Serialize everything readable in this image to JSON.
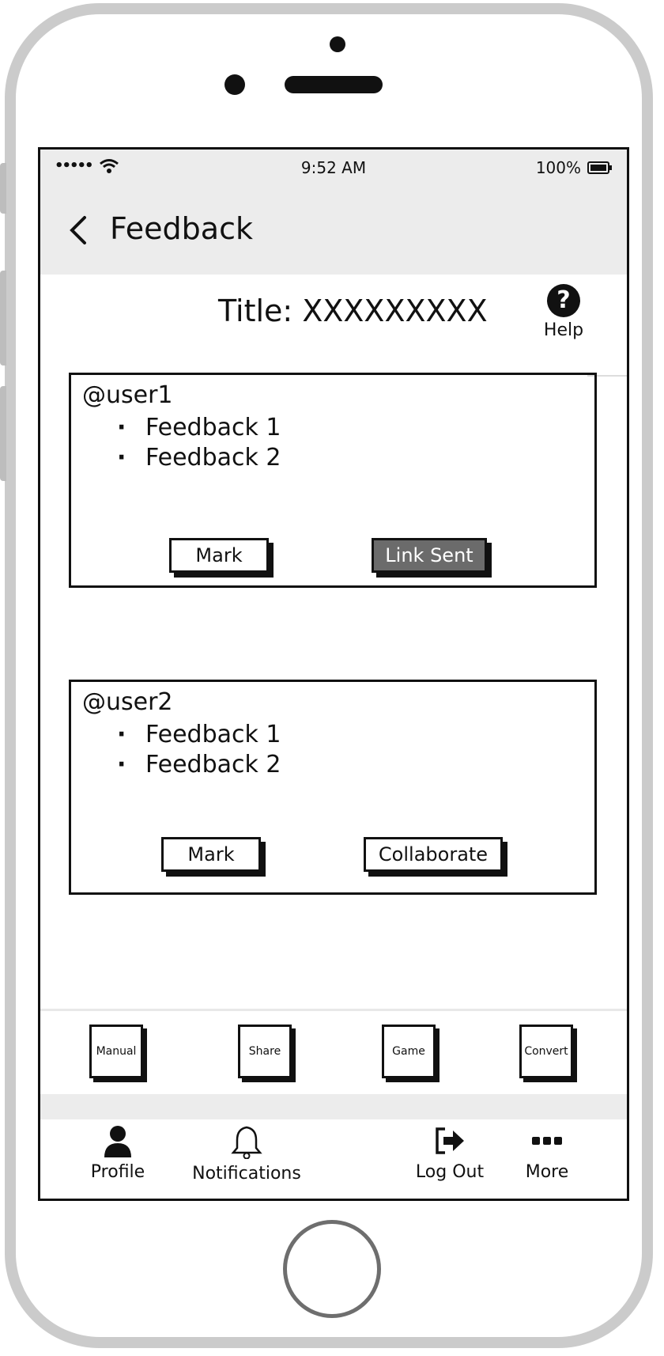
{
  "status_bar": {
    "signal": "•••••",
    "time": "9:52 AM",
    "battery": "100%"
  },
  "nav": {
    "back_icon": "chevron-left-icon",
    "title": "Feedback"
  },
  "page": {
    "title": "Title: XXXXXXXXX",
    "help_label": "Help"
  },
  "cards": [
    {
      "user": "@user1",
      "items": [
        "Feedback 1",
        "Feedback 2"
      ],
      "primary_label": "Mark",
      "secondary_label": "Link Sent"
    },
    {
      "user": "@user2",
      "items": [
        "Feedback 1",
        "Feedback 2"
      ],
      "primary_label": "Mark",
      "secondary_label": "Collaborate"
    }
  ],
  "quick_actions": [
    "Manual",
    "Share",
    "Game",
    "Convert"
  ],
  "tabs": [
    {
      "label": "Profile",
      "icon": "user-icon"
    },
    {
      "label": "Notifications",
      "icon": "bell-icon"
    },
    {
      "label": "Log Out",
      "icon": "sign-out-icon"
    },
    {
      "label": "More",
      "icon": "more-icon"
    }
  ],
  "colors": {
    "bar_bg": "#ececec",
    "shell": "#cbcbcb",
    "dark_button": "#6b6b6b"
  }
}
